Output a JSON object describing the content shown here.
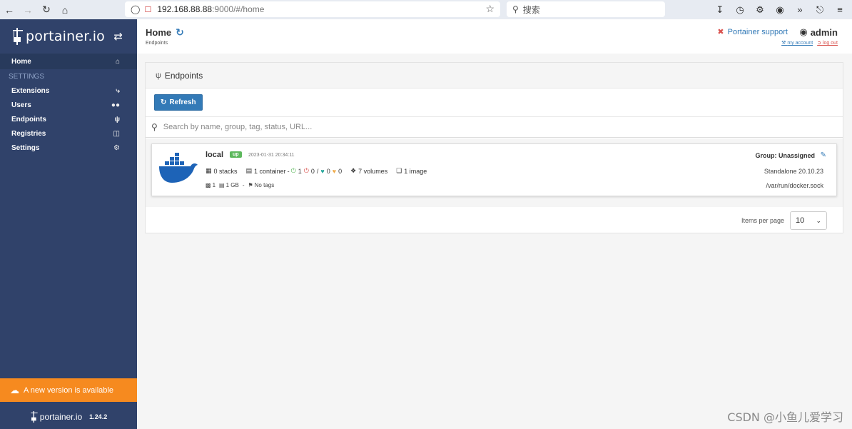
{
  "browser": {
    "url_host": "192.168.88.88",
    "url_path": ":9000/#/home",
    "search_placeholder": "搜索"
  },
  "sidebar": {
    "logo": "portainer.io",
    "items": [
      {
        "label": "Home",
        "icon": "home-icon"
      },
      {
        "label": "Extensions",
        "icon": "bolt-icon"
      },
      {
        "label": "Users",
        "icon": "users-icon"
      },
      {
        "label": "Endpoints",
        "icon": "plug-icon"
      },
      {
        "label": "Registries",
        "icon": "database-icon"
      },
      {
        "label": "Settings",
        "icon": "cogs-icon"
      }
    ],
    "section": "SETTINGS",
    "update_notice": "A new version is available",
    "footer_logo": "portainer.io",
    "version": "1.24.2"
  },
  "header": {
    "title": "Home",
    "breadcrumb": "Endpoints",
    "support": "Portainer support",
    "user": "admin",
    "my_account": "my account",
    "logout": "log out"
  },
  "panel": {
    "title": "Endpoints",
    "refresh_label": "Refresh",
    "search_placeholder": "Search by name, group, tag, status, URL..."
  },
  "endpoint": {
    "name": "local",
    "status": "up",
    "timestamp": "2023-01-31 20:34:11",
    "stacks": "0 stacks",
    "containers": "1 container",
    "running": "1",
    "stopped": "0",
    "healthy": "0",
    "unhealthy": "0",
    "volumes": "7 volumes",
    "images": "1 image",
    "cpu": "1",
    "memory": "1 GB",
    "tags": "No tags",
    "group": "Group: Unassigned",
    "docker_version": "Standalone 20.10.23",
    "url": "/var/run/docker.sock"
  },
  "pagination": {
    "label": "Items per page",
    "value": "10"
  },
  "watermark": "CSDN @小鱼儿爱学习",
  "colors": {
    "sidebar": "#30426a",
    "accent": "#337ab7",
    "update": "#f68a1f",
    "up": "#5cb85c"
  }
}
